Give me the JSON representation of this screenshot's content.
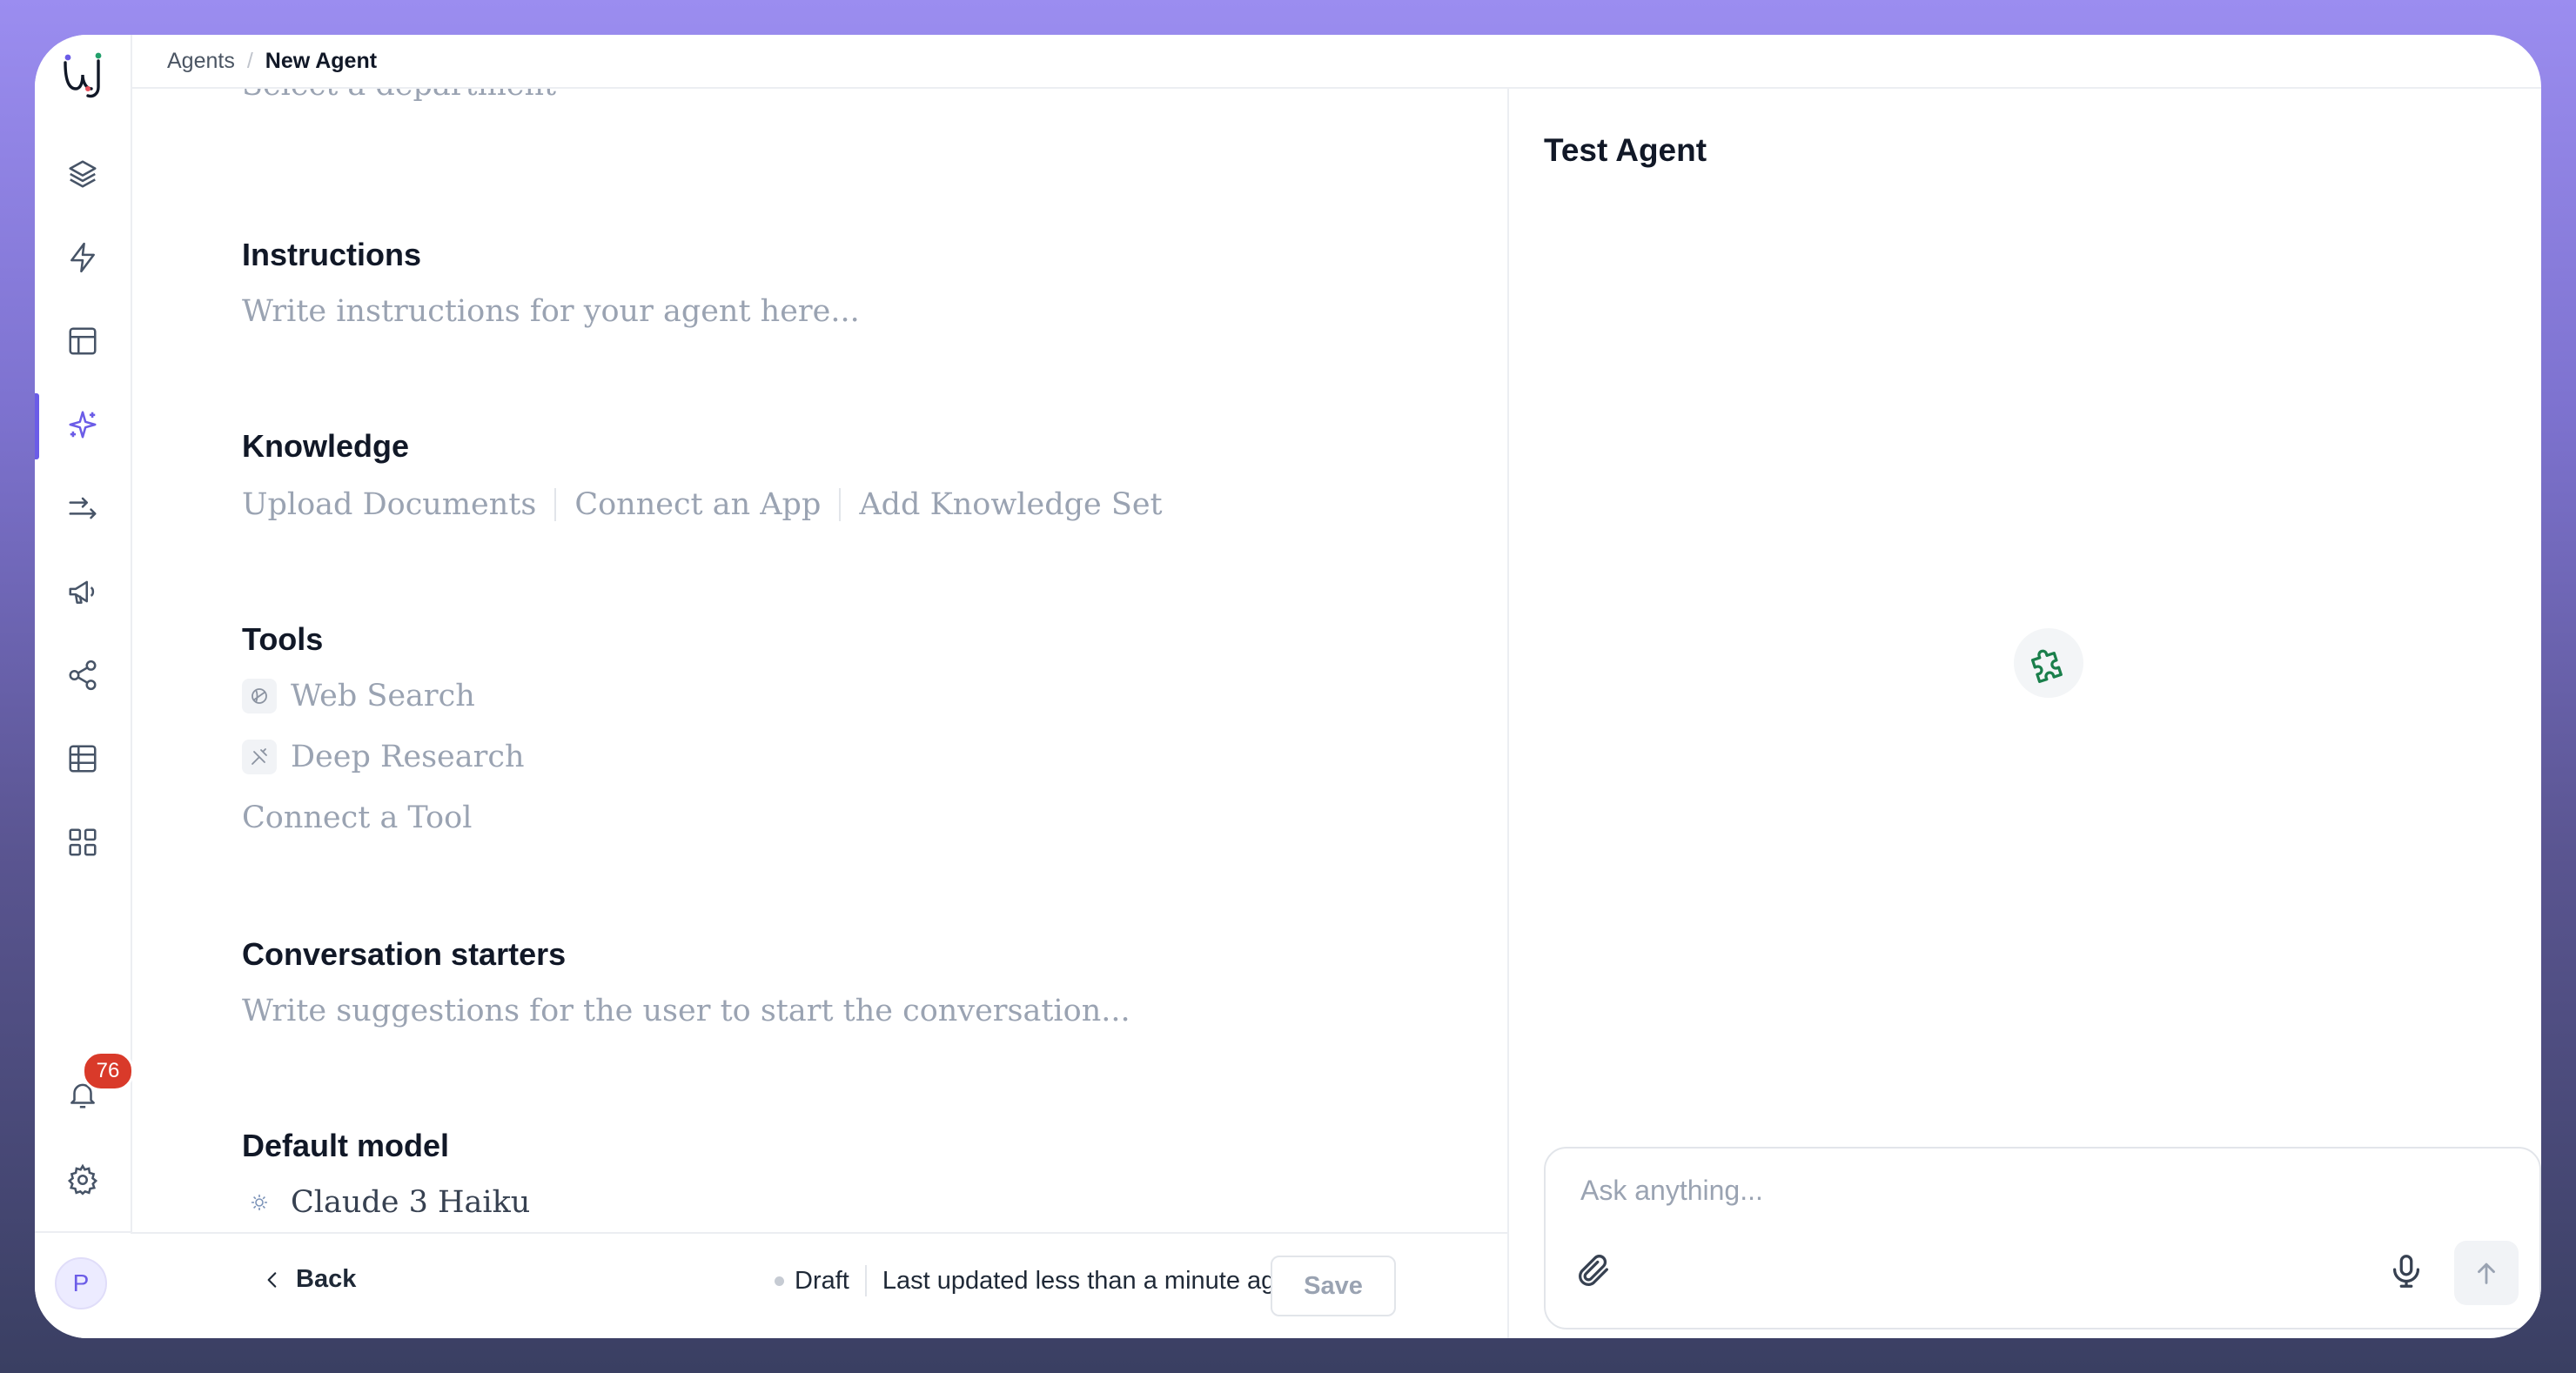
{
  "breadcrumb": {
    "parent": "Agents",
    "separator": "/",
    "current": "New Agent"
  },
  "sidebar": {
    "items": [
      {
        "icon": "layers-icon"
      },
      {
        "icon": "bolt-icon"
      },
      {
        "icon": "layout-icon"
      },
      {
        "icon": "sparkles-icon",
        "active": true
      },
      {
        "icon": "arrows-icon"
      },
      {
        "icon": "megaphone-icon"
      },
      {
        "icon": "share-icon"
      },
      {
        "icon": "table-icon"
      },
      {
        "icon": "apps-grid-icon"
      }
    ],
    "notifications_count": "76",
    "avatar_initial": "P"
  },
  "form": {
    "department_placeholder": "Select a department",
    "instructions": {
      "title": "Instructions",
      "placeholder": "Write instructions for your agent here..."
    },
    "knowledge": {
      "title": "Knowledge",
      "links": [
        "Upload Documents",
        "Connect an App",
        "Add Knowledge Set"
      ]
    },
    "tools": {
      "title": "Tools",
      "items": [
        {
          "label": "Web Search",
          "icon": "web-search-icon"
        },
        {
          "label": "Deep Research",
          "icon": "deep-research-icon"
        }
      ],
      "connect_label": "Connect a Tool"
    },
    "conversation_starters": {
      "title": "Conversation starters",
      "placeholder": "Write suggestions for the user to start the conversation..."
    },
    "default_model": {
      "title": "Default model",
      "value": "Claude 3 Haiku",
      "icon": "model-icon"
    }
  },
  "footer": {
    "back_label": "Back",
    "status_label": "Draft",
    "updated_text": "Last updated less than a minute ago",
    "save_label": "Save"
  },
  "test_panel": {
    "title": "Test Agent",
    "input_placeholder": "Ask anything...",
    "center_icon": "puzzle-icon"
  },
  "colors": {
    "accent": "#6b5ce7",
    "badge": "#d93a2a",
    "puzzle": "#1a7f4b"
  }
}
